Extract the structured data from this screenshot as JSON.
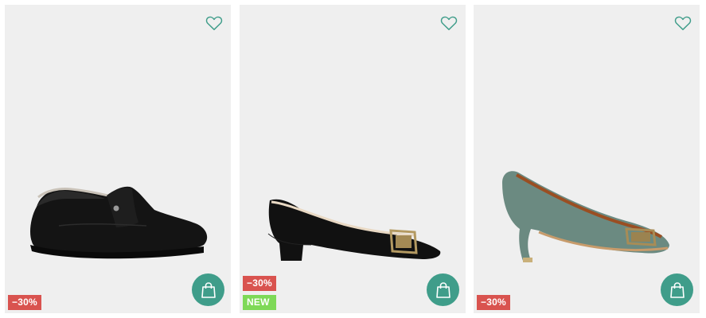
{
  "colors": {
    "card_bg": "#efefef",
    "accent": "#3f9d8a",
    "sale_badge": "#d9534f",
    "new_badge": "#7ed957"
  },
  "products": [
    {
      "image_icon": "black-leather-velcro-shoe",
      "favorite_icon": "heart-outline-icon",
      "cart_icon": "shopping-bag-icon",
      "badges": {
        "discount": "−30%"
      }
    },
    {
      "image_icon": "black-suede-buckle-pump",
      "favorite_icon": "heart-outline-icon",
      "cart_icon": "shopping-bag-icon",
      "badges": {
        "discount": "−30%",
        "new": "NEW"
      }
    },
    {
      "image_icon": "green-suede-kitten-heel",
      "favorite_icon": "heart-outline-icon",
      "cart_icon": "shopping-bag-icon",
      "badges": {
        "discount": "−30%"
      }
    }
  ]
}
